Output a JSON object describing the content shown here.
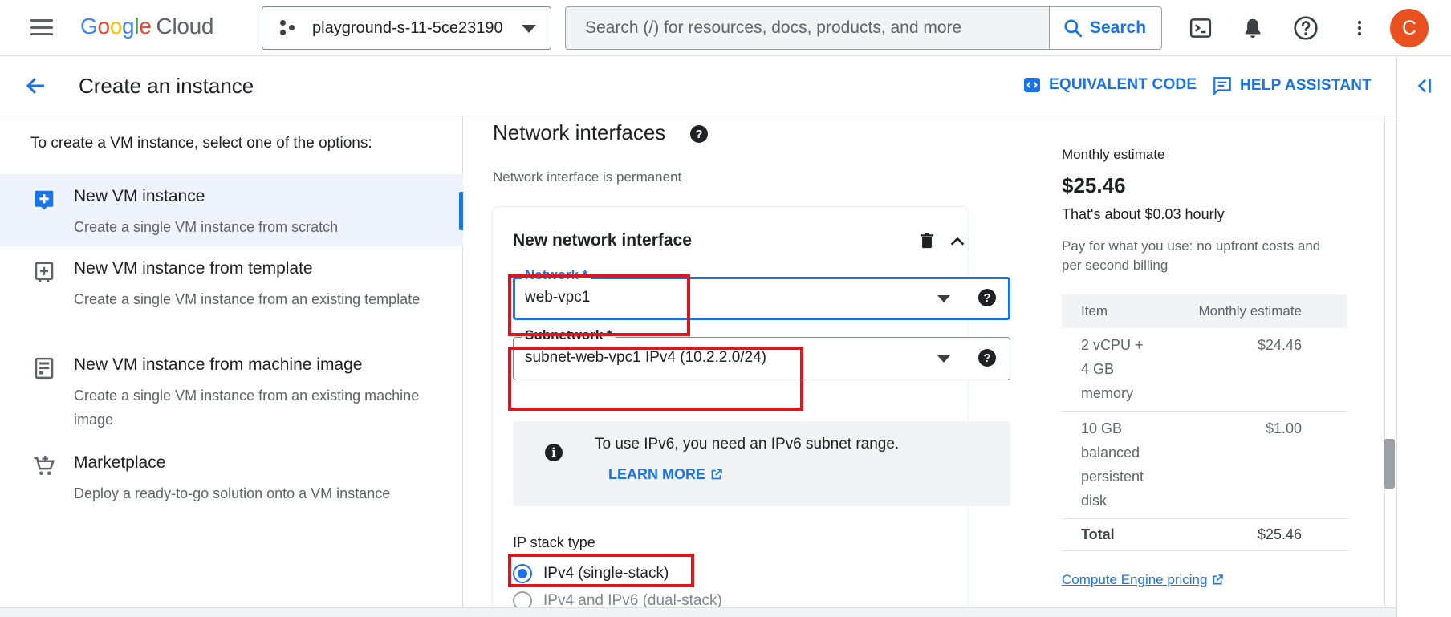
{
  "topbar": {
    "logo_google": "Google",
    "logo_cloud": "Cloud",
    "project_name": "playground-s-11-5ce23190",
    "search_placeholder": "Search (/) for resources, docs, products, and more",
    "search_button": "Search",
    "avatar_letter": "C",
    "icons": [
      "menu-icon",
      "cloud-shell-icon",
      "notifications-icon",
      "help-icon",
      "more-vert-icon"
    ]
  },
  "titlebar": {
    "title": "Create an instance",
    "equivalent_code": "EQUIVALENT CODE",
    "help_assistant": "HELP ASSISTANT"
  },
  "sidebar": {
    "hint": "To create a VM instance, select one of the options:",
    "options": [
      {
        "title": "New VM instance",
        "desc": "Create a single VM instance from scratch",
        "icon": "add-box-icon",
        "selected": true
      },
      {
        "title": "New VM instance from template",
        "desc": "Create a single VM instance from an existing template",
        "icon": "template-icon",
        "selected": false
      },
      {
        "title": "New VM instance from machine image",
        "desc": "Create a single VM instance from an existing machine image",
        "icon": "machine-image-icon",
        "selected": false
      },
      {
        "title": "Marketplace",
        "desc": "Deploy a ready-to-go solution onto a VM instance",
        "icon": "shopping-cart-icon",
        "selected": false
      }
    ]
  },
  "network": {
    "section_title": "Network interfaces",
    "section_sub": "Network interface is permanent",
    "card_title": "New network interface",
    "network_label": "Network *",
    "network_value": "web-vpc1",
    "subnetwork_label": "Subnetwork *",
    "subnetwork_value": "subnet-web-vpc1 IPv4 (10.2.2.0/24)",
    "ipv6_info": "To use IPv6, you need an IPv6 subnet range.",
    "learn_more": "LEARN MORE",
    "ip_stack_label": "IP stack type",
    "ip_options": [
      {
        "label": "IPv4 (single-stack)",
        "selected": true
      },
      {
        "label": "IPv4 and IPv6 (dual-stack)",
        "selected": false
      }
    ]
  },
  "estimate": {
    "label": "Monthly estimate",
    "amount": "$25.46",
    "hourly": "That's about $0.03 hourly",
    "note": "Pay for what you use: no upfront costs and per second billing",
    "table_headers": [
      "Item",
      "Monthly estimate"
    ],
    "rows": [
      {
        "item": "2 vCPU + 4 GB memory",
        "cost": "$24.46"
      },
      {
        "item": "10 GB balanced persistent disk",
        "cost": "$1.00"
      }
    ],
    "total_label": "Total",
    "total_value": "$25.46",
    "pricing_link": "Compute Engine pricing"
  },
  "colors": {
    "accent": "#1a73e8",
    "highlight": "#e0141c",
    "avatar": "#e8501f"
  }
}
